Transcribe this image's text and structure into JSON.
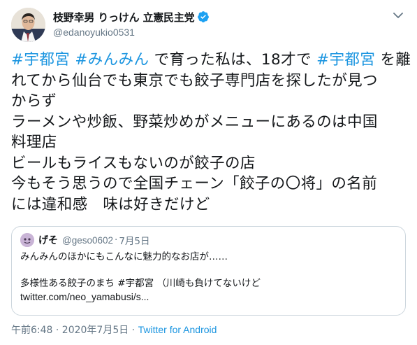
{
  "author": {
    "display_name": "枝野幸男 りっけん 立憲民主党",
    "handle": "@edanoyukio0531",
    "verified": true
  },
  "tweet": {
    "lines": [
      [
        {
          "t": "#宇都宮",
          "tag": true
        },
        {
          "t": " "
        },
        {
          "t": "#みんみん",
          "tag": true
        },
        {
          "t": " で育った私は、18才で "
        },
        {
          "t": "#宇都宮",
          "tag": true
        },
        {
          "t": " を離"
        }
      ],
      [
        {
          "t": "れてから仙台でも東京でも餃子専門店を探したが見つ"
        }
      ],
      [
        {
          "t": "からず"
        }
      ],
      [
        {
          "t": "ラーメンや炒飯、野菜炒めがメニューにあるのは中国"
        }
      ],
      [
        {
          "t": "料理店"
        }
      ],
      [
        {
          "t": "ビールもライスもないのが餃子の店"
        }
      ],
      [
        {
          "t": "今もそう思うので全国チェーン「餃子の〇将」の名前"
        }
      ],
      [
        {
          "t": "には違和感　味は好きだけど"
        }
      ]
    ]
  },
  "quote": {
    "display_name": "げそ",
    "handle": "@geso0602",
    "separator": "·",
    "date": "7月5日",
    "line1": "みんみんのほかにもこんなに魅力的なお店が……",
    "line2": "多様性ある餃子のまち #宇都宮 （川崎も負けてないけど",
    "link": "twitter.com/neo_yamabusi/s..."
  },
  "meta": {
    "timestamp": "午前6:48 · 2020年7月5日 · ",
    "client": "Twitter for Android"
  },
  "colors": {
    "accent": "#1b95e0",
    "muted": "#657786",
    "border": "#ccd6dd",
    "verified": "#1da1f2"
  },
  "icons": {
    "caret": "chevron-down-icon",
    "verified": "verified-badge-icon"
  }
}
